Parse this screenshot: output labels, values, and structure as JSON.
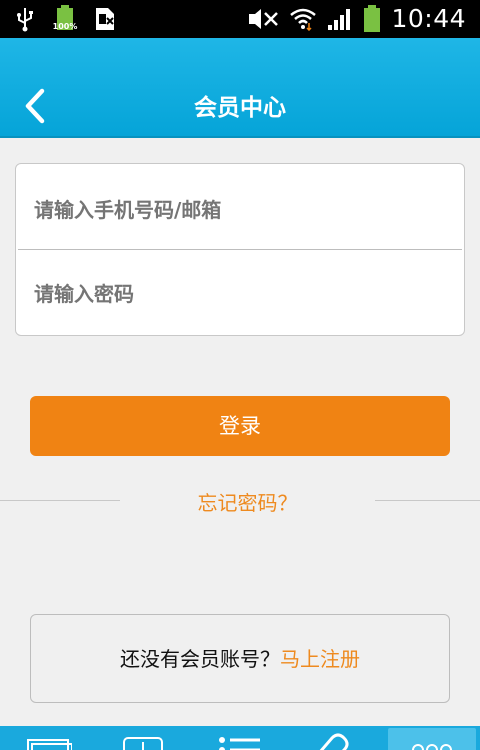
{
  "status_bar": {
    "battery_percent": "100%",
    "time": "10:44"
  },
  "header": {
    "title": "会员中心"
  },
  "login_form": {
    "account_placeholder": "请输入手机号码/邮箱",
    "password_placeholder": "请输入密码"
  },
  "login_button": {
    "label": "登录"
  },
  "forgot_password": {
    "label": "忘记密码？"
  },
  "register": {
    "prompt": "还没有会员账号？",
    "link": "马上注册"
  },
  "colors": {
    "header": "#05a4d8",
    "accent": "#f08313",
    "link": "#ee8a1f",
    "background": "#f0f0f0"
  },
  "icons": {
    "status_left": [
      "usb-icon",
      "battery-full-icon",
      "keyboard-icon"
    ],
    "status_right": [
      "mute-icon",
      "wifi-icon",
      "signal-icon",
      "battery-icon"
    ],
    "nav": [
      "folder-icon",
      "download-icon",
      "list-icon",
      "clip-icon",
      "more-icon"
    ]
  }
}
